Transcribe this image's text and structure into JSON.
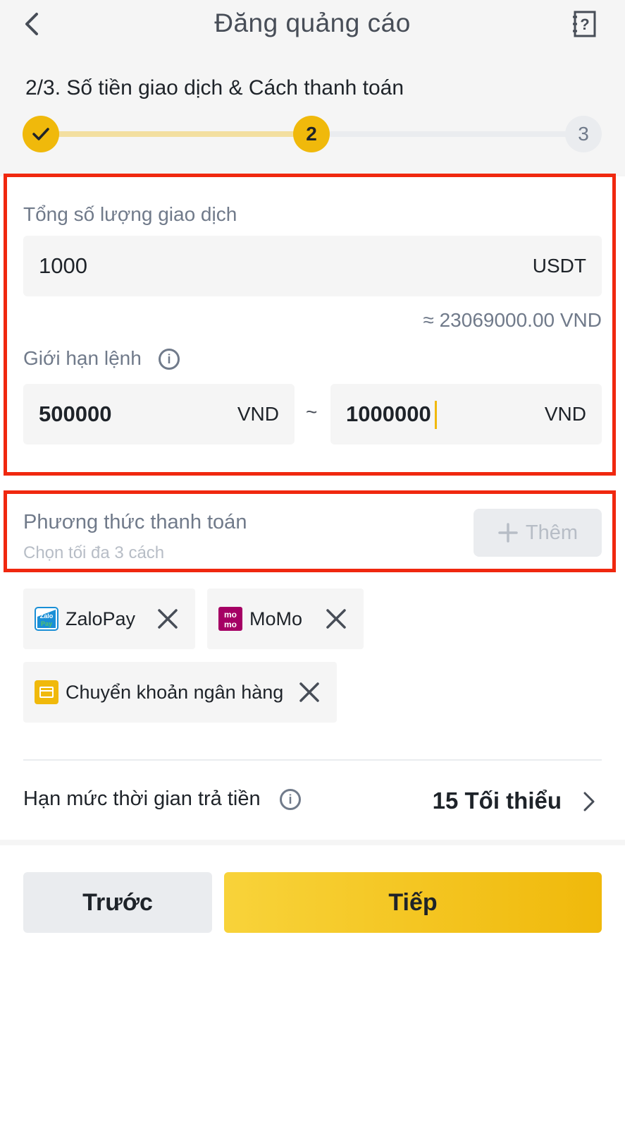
{
  "header": {
    "title": "Đăng quảng cáo",
    "back_icon": "chevron-left-icon",
    "help_icon": "help-book-icon"
  },
  "steps": {
    "title": "2/3. Số tiền giao dịch & Cách thanh toán",
    "current": 2,
    "total": 3,
    "step2_label": "2",
    "step3_label": "3"
  },
  "amount": {
    "label": "Tổng số lượng giao dịch",
    "value": "1000",
    "unit": "USDT",
    "approx": "≈ 23069000.00 VND"
  },
  "limit": {
    "label": "Giới hạn lệnh",
    "min_value": "500000",
    "min_unit": "VND",
    "separator": "~",
    "max_value": "1000000",
    "max_unit": "VND"
  },
  "payment": {
    "label": "Phương thức thanh toán",
    "hint": "Chọn tối đa 3 cách",
    "add_label": "Thêm",
    "methods": [
      {
        "label": "ZaloPay",
        "icon": "zalopay-icon",
        "color": "#1a8fd6"
      },
      {
        "label": "MoMo",
        "icon": "momo-icon",
        "color": "#a50064"
      },
      {
        "label": "Chuyển khoản ngân hàng",
        "icon": "bank-card-icon",
        "color": "#f0b90b"
      }
    ]
  },
  "time_limit": {
    "label": "Hạn mức thời gian trả tiền",
    "value": "15 Tối thiểu"
  },
  "buttons": {
    "prev": "Trước",
    "next": "Tiếp"
  },
  "colors": {
    "accent": "#f0b90b",
    "highlight": "#f0280f"
  }
}
